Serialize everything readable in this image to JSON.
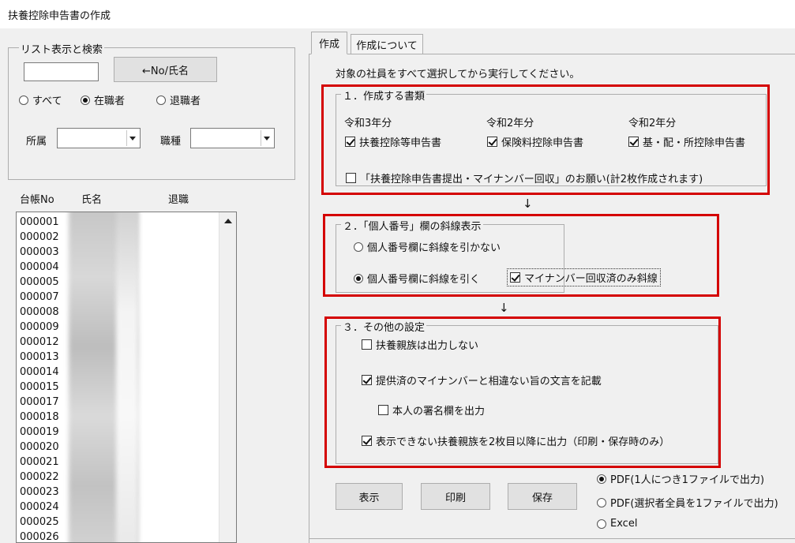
{
  "window": {
    "title": "扶養控除申告書の作成"
  },
  "left_panel": {
    "search_group": {
      "legend": "リスト表示と検索",
      "search_value": "",
      "search_button": "←No/氏名",
      "radios": [
        {
          "label": "すべて",
          "checked": false
        },
        {
          "label": "在職者",
          "checked": true
        },
        {
          "label": "退職者",
          "checked": false
        }
      ],
      "affiliation_label": "所属",
      "affiliation_value": "",
      "job_type_label": "職種",
      "job_type_value": ""
    },
    "list": {
      "headers": [
        "台帳No",
        "氏名",
        "退職"
      ],
      "rows": [
        "000001",
        "000002",
        "000003",
        "000004",
        "000005",
        "000007",
        "000008",
        "000009",
        "000012",
        "000013",
        "000014",
        "000015",
        "000017",
        "000018",
        "000019",
        "000020",
        "000021",
        "000022",
        "000023",
        "000024",
        "000025",
        "000026"
      ]
    }
  },
  "tabs": [
    {
      "label": "作成",
      "active": true
    },
    {
      "label": "作成について",
      "active": false
    }
  ],
  "main": {
    "instruction": "対象の社員をすべて選択してから実行してください。",
    "section1": {
      "legend": "１．作成する書類",
      "columns": [
        {
          "year": "令和3年分",
          "label": "扶養控除等申告書",
          "checked": true
        },
        {
          "year": "令和2年分",
          "label": "保険料控除申告書",
          "checked": true
        },
        {
          "year": "令和2年分",
          "label": "基・配・所控除申告書",
          "checked": true
        }
      ],
      "request": {
        "label": "「扶養控除申告書提出・マイナンバー回収」のお願い(計2枚作成されます)",
        "checked": false
      }
    },
    "section2": {
      "legend": "２．「個人番号」欄の斜線表示",
      "option_no_line": {
        "label": "個人番号欄に斜線を引かない",
        "checked": false
      },
      "option_line": {
        "label": "個人番号欄に斜線を引く",
        "checked": true
      },
      "collected_only": {
        "label": "マイナンバー回収済のみ斜線",
        "checked": true
      }
    },
    "section3": {
      "legend": "３．その他の設定",
      "no_dependents": {
        "label": "扶養親族は出力しない",
        "checked": false
      },
      "statement": {
        "label": "提供済のマイナンバーと相違ない旨の文言を記載",
        "checked": true
      },
      "signature": {
        "label": "本人の署名欄を出力",
        "checked": false
      },
      "overflow": {
        "label": "表示できない扶養親族を2枚目以降に出力（印刷・保存時のみ）",
        "checked": true
      }
    },
    "buttons": {
      "display": "表示",
      "print": "印刷",
      "save": "保存"
    },
    "output_options": [
      {
        "label": "PDF(1人につき1ファイルで出力)",
        "checked": true
      },
      {
        "label": "PDF(選択者全員を1ファイルで出力)",
        "checked": false
      },
      {
        "label": "Excel",
        "checked": false
      }
    ],
    "flow_arrow": "↓"
  },
  "colors": {
    "highlight_border": "#d40000",
    "window_bg": "#f0f0f0"
  }
}
